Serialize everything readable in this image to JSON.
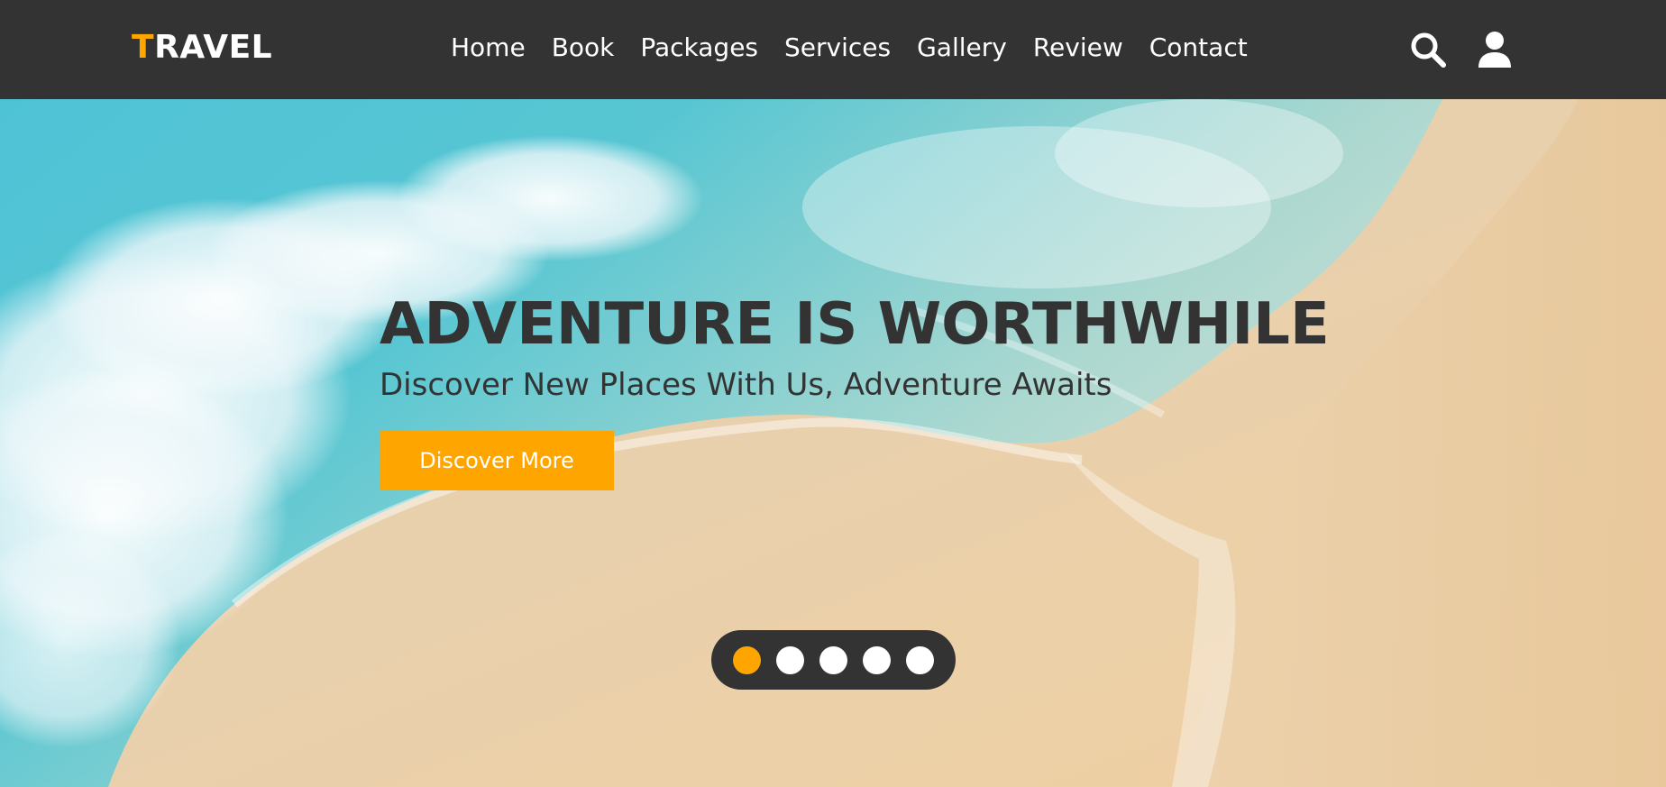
{
  "header": {
    "logo_first": "T",
    "logo_rest": "RAVEL",
    "nav": [
      {
        "label": "Home"
      },
      {
        "label": "Book"
      },
      {
        "label": "Packages"
      },
      {
        "label": "Services"
      },
      {
        "label": "Gallery"
      },
      {
        "label": "Review"
      },
      {
        "label": "Contact"
      }
    ],
    "icons": [
      "search-icon",
      "user-icon"
    ]
  },
  "hero": {
    "title": "ADVENTURE IS WORTHWHILE",
    "subtitle": "Discover New Places With Us, Adventure Awaits",
    "button_label": "Discover More",
    "slides_total": 5,
    "active_slide": 1
  },
  "colors": {
    "header_bg": "#333333",
    "accent": "#ffa500",
    "text_dark": "#333333",
    "text_light": "#ffffff"
  }
}
